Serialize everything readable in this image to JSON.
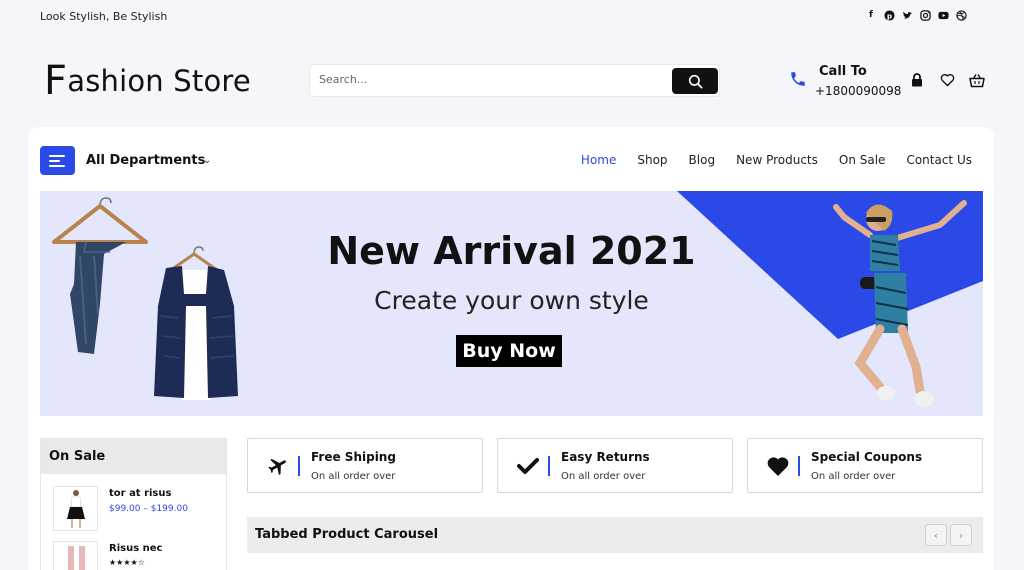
{
  "topbar": {
    "tagline": "Look Stylish, Be Stylish"
  },
  "social_icons": [
    "facebook-icon",
    "pinterest-icon",
    "twitter-icon",
    "instagram-icon",
    "youtube-icon",
    "dribbble-icon"
  ],
  "header": {
    "logo_initial": "F",
    "logo_rest": "ashion Store",
    "search_placeholder": "Search...",
    "call_label": "Call To",
    "phone": "+1800090098"
  },
  "nav": {
    "departments_label": "All Departments",
    "items": [
      "Home",
      "Shop",
      "Blog",
      "New Products",
      "On Sale",
      "Contact Us"
    ],
    "active": "Home"
  },
  "banner": {
    "title": "New Arrival 2021",
    "subtitle": "Create your own style",
    "button_label": "Buy Now"
  },
  "sidebar": {
    "title": "On Sale",
    "items": [
      {
        "name": "tor at risus",
        "price": "$99.00 – $199.00"
      },
      {
        "name": "Risus nec",
        "rating": "★★★★☆"
      }
    ]
  },
  "features": [
    {
      "title": "Free Shiping",
      "subtitle": "On all order over",
      "icon": "airplane-icon"
    },
    {
      "title": "Easy Returns",
      "subtitle": "On all order over",
      "icon": "checkmark-icon"
    },
    {
      "title": "Special Coupons",
      "subtitle": "On all order over",
      "icon": "heart-icon"
    }
  ],
  "carousel": {
    "title": "Tabbed Product Carousel",
    "prev_label": "‹",
    "next_label": "›"
  },
  "colors": {
    "accent": "#2b49e6",
    "banner_bg": "#e4e6fb",
    "page_bg": "#f5f6fa"
  }
}
